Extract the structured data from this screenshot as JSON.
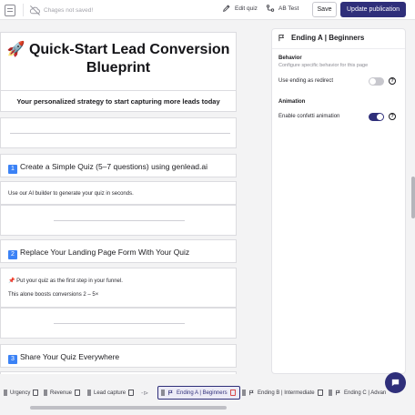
{
  "topbar": {
    "unsaved_text": "Chages not saved!",
    "edit_quiz_label": "Edit quiz",
    "ab_test_label": "AB Test",
    "save_label": "Save",
    "publish_label": "Update publication"
  },
  "canvas": {
    "hero_emoji": "🚀",
    "hero_title": "Quick-Start Lead Conversion Blueprint",
    "subtitle": "Your personalized strategy to start capturing more leads today",
    "step1_num": "1",
    "step1_title": "Create a Simple Quiz (5–7 questions) using genlead.ai",
    "step1_text": "Use our AI builder to generate your quiz in seconds.",
    "step2_num": "2",
    "step2_title": "Replace Your Landing Page Form With Your Quiz",
    "step2_pin": "📌",
    "step2_text1": "Put your quiz as the first step in your funnel.",
    "step2_text2": "This alone boosts conversions 2 – 5×",
    "step3_num": "3",
    "step3_title": "Share Your Quiz Everywhere"
  },
  "panel": {
    "title": "Ending A | Beginners",
    "behavior_title": "Behavior",
    "behavior_desc": "Configure specific behavior for this page",
    "use_redirect_label": "Use ending as redirect",
    "use_redirect_on": false,
    "animation_title": "Animation",
    "confetti_label": "Enable confetti animation",
    "confetti_on": true,
    "help_glyph": "?"
  },
  "tabs": [
    {
      "label": "Urgency"
    },
    {
      "label": "Revenue"
    },
    {
      "label": "Lead capture"
    },
    {
      "label": "Ending A | Beginners"
    },
    {
      "label": "Ending B | Intermediate"
    },
    {
      "label": "Ending C | Advan"
    }
  ],
  "tab_arrow": "-⊳",
  "colors": {
    "accent": "#2f2f7a",
    "step_badge": "#3b82f6",
    "danger": "#d84a4a"
  },
  "icons": [
    "file-icon",
    "cloud-off-icon",
    "pencil-icon",
    "ab-test-icon",
    "flag-icon",
    "help-icon",
    "trash-icon",
    "grip-icon",
    "chat-icon"
  ]
}
